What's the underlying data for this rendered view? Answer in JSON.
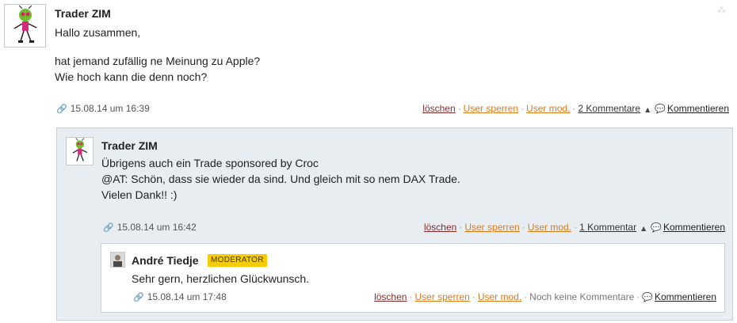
{
  "corner_mark": "⸻",
  "post": {
    "author": "Trader ZIM",
    "lines": [
      "Hallo zusammen,",
      "hat jemand zufällig ne Meinung zu Apple?",
      "Wie hoch kann die denn noch?"
    ],
    "date": "15.08.14 um 16:39",
    "actions": {
      "delete": "löschen",
      "ban_user": "User sperren",
      "user_mod": "User mod.",
      "comment_count": "2 Kommentare",
      "comment": "Kommentieren"
    }
  },
  "reply1": {
    "author": "Trader ZIM",
    "lines": [
      "Übrigens auch ein Trade sponsored by Croc",
      "@AT: Schön, dass sie wieder da sind. Und gleich mit so nem DAX Trade.",
      "Vielen Dank!! :)"
    ],
    "date": "15.08.14 um 16:42",
    "actions": {
      "delete": "löschen",
      "ban_user": "User sperren",
      "user_mod": "User mod.",
      "comment_count": "1 Kommentar",
      "comment": "Kommentieren"
    }
  },
  "reply2": {
    "author": "André Tiedje",
    "badge": "MODERATOR",
    "lines": [
      "Sehr gern, herzlichen Glückwunsch."
    ],
    "date": "15.08.14 um 17:48",
    "actions": {
      "delete": "löschen",
      "ban_user": "User sperren",
      "user_mod": "User mod.",
      "no_comments": "Noch keine Kommentare",
      "comment": "Kommentieren"
    }
  },
  "colors": {
    "delete": "#8a2a2a",
    "moderation": "#e07b1c",
    "reply_bg": "#e8edf2",
    "badge": "#f5cd00"
  },
  "icons": {
    "permalink": "link-icon",
    "collapse": "caret-up-icon",
    "comment": "speech-bubble-icon"
  }
}
